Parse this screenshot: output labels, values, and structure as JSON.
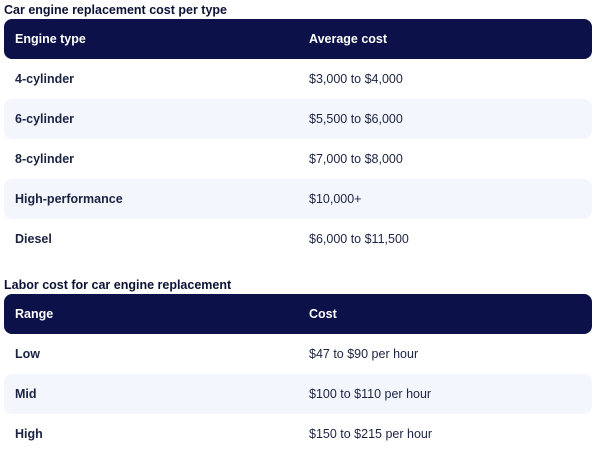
{
  "engine_section": {
    "title": "Car engine replacement cost per type",
    "columns": [
      "Engine type",
      "Average cost"
    ],
    "rows": [
      [
        "4-cylinder",
        "$3,000 to $4,000"
      ],
      [
        "6-cylinder",
        "$5,500 to $6,000"
      ],
      [
        "8-cylinder",
        "$7,000 to $8,000"
      ],
      [
        "High-performance",
        "$10,000+"
      ],
      [
        "Diesel",
        "$6,000 to $11,500"
      ]
    ]
  },
  "labor_section": {
    "title": "Labor cost for car engine replacement",
    "columns": [
      "Range",
      "Cost"
    ],
    "rows": [
      [
        "Low",
        "$47 to $90 per hour"
      ],
      [
        "Mid",
        "$100 to $110 per hour"
      ],
      [
        "High",
        "$150 to $215 per hour"
      ]
    ]
  },
  "colors": {
    "header_bg": "#0c1249",
    "alt_row_bg": "#f3f6fc",
    "text": "#1b2342"
  }
}
